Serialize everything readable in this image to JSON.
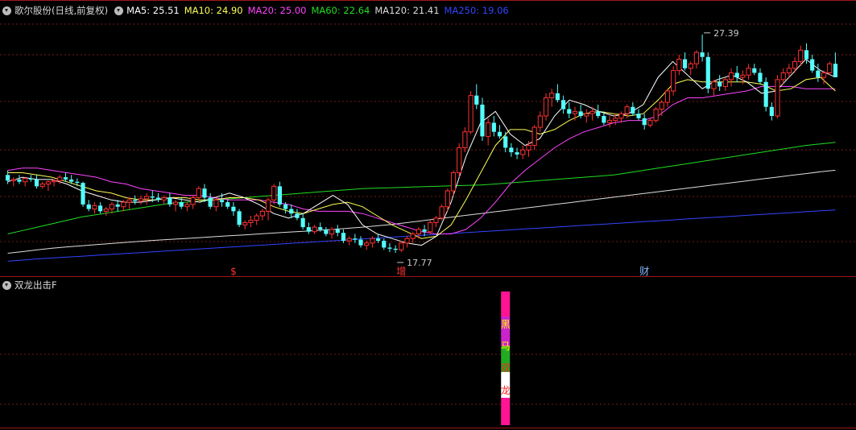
{
  "main_panel": {
    "title": "歌尔股份(日线,前复权)",
    "ma_legend": [
      {
        "label": "MA5: 25.51",
        "color": "#ffffff"
      },
      {
        "label": "MA10: 24.90",
        "color": "#ffff55"
      },
      {
        "label": "MA20: 25.00",
        "color": "#ff44ff"
      },
      {
        "label": "MA60: 22.64",
        "color": "#22dd22"
      },
      {
        "label": "MA120: 21.41",
        "color": "#dddddd"
      },
      {
        "label": "MA250: 19.06",
        "color": "#3344ff"
      }
    ],
    "high_label": "27.39",
    "low_label": "17.77",
    "markers": [
      {
        "text": "$",
        "color": "#ff3333",
        "day": 39
      },
      {
        "text": "增",
        "color": "#ff3333",
        "day": 68
      },
      {
        "text": "财",
        "color": "#88bbff",
        "day": 110
      },
      {
        "text": "$",
        "color": "#ff3333",
        "day": 160
      }
    ]
  },
  "sub_panel": {
    "title": "双龙出击F",
    "signals": [
      {
        "day": 86,
        "chars": [
          "黑",
          "马",
          "双",
          "龙"
        ],
        "char_colors": [
          "#ffff00",
          "#ffff00",
          "#ff2222",
          "#ff2222"
        ]
      },
      {
        "day": 157,
        "chars": [
          "黑",
          "马",
          "双",
          "龙"
        ],
        "char_colors": [
          "#ffff00",
          "#ffff00",
          "#ff2222",
          "#ff2222"
        ]
      }
    ]
  },
  "colors": {
    "up": "#ff3232",
    "down": "#54ffff",
    "grid": "#7a1a1a",
    "label": "#c8c8c8"
  },
  "chart_data": {
    "type": "candlestick",
    "price_range": [
      17.2,
      28.2
    ],
    "candles": [
      [
        21.2,
        21.4,
        20.8,
        20.95
      ],
      [
        20.95,
        21.1,
        20.7,
        21.0
      ],
      [
        21.0,
        21.2,
        20.8,
        20.9
      ],
      [
        20.9,
        21.1,
        20.7,
        21.05
      ],
      [
        21.05,
        21.2,
        20.9,
        21.0
      ],
      [
        21.0,
        21.2,
        20.6,
        20.7
      ],
      [
        20.7,
        20.9,
        20.6,
        20.8
      ],
      [
        20.8,
        20.95,
        20.5,
        20.9
      ],
      [
        20.9,
        21.0,
        20.7,
        20.95
      ],
      [
        20.95,
        21.2,
        20.8,
        21.1
      ],
      [
        21.1,
        21.3,
        20.9,
        21.0
      ],
      [
        21.0,
        21.2,
        20.8,
        20.9
      ],
      [
        20.9,
        21.05,
        20.7,
        20.85
      ],
      [
        20.85,
        20.9,
        19.8,
        19.9
      ],
      [
        19.9,
        20.1,
        19.6,
        19.7
      ],
      [
        19.7,
        20.0,
        19.5,
        19.85
      ],
      [
        19.85,
        20.0,
        19.5,
        19.6
      ],
      [
        19.6,
        19.8,
        19.4,
        19.7
      ],
      [
        19.7,
        20.0,
        19.5,
        19.9
      ],
      [
        19.9,
        20.1,
        19.6,
        19.8
      ],
      [
        19.8,
        20.1,
        19.6,
        20.0
      ],
      [
        20.0,
        20.2,
        19.7,
        20.1
      ],
      [
        20.1,
        20.3,
        19.9,
        20.05
      ],
      [
        20.05,
        20.3,
        19.9,
        20.15
      ],
      [
        20.15,
        20.4,
        19.9,
        20.25
      ],
      [
        20.25,
        20.5,
        20.0,
        20.2
      ],
      [
        20.2,
        20.4,
        20.0,
        20.1
      ],
      [
        20.1,
        20.3,
        19.9,
        20.2
      ],
      [
        20.2,
        20.4,
        19.8,
        19.9
      ],
      [
        19.9,
        20.1,
        19.6,
        20.0
      ],
      [
        20.0,
        20.2,
        19.7,
        19.8
      ],
      [
        19.8,
        20.0,
        19.6,
        19.9
      ],
      [
        19.9,
        20.3,
        19.7,
        20.2
      ],
      [
        20.2,
        20.7,
        20.0,
        20.6
      ],
      [
        20.6,
        20.8,
        20.0,
        20.2
      ],
      [
        20.2,
        20.4,
        19.7,
        19.8
      ],
      [
        19.8,
        20.2,
        19.6,
        20.1
      ],
      [
        20.1,
        20.4,
        19.8,
        20.0
      ],
      [
        20.0,
        20.1,
        19.7,
        19.8
      ],
      [
        19.8,
        20.0,
        19.4,
        19.6
      ],
      [
        19.6,
        19.7,
        18.9,
        19.0
      ],
      [
        19.0,
        19.2,
        18.8,
        19.1
      ],
      [
        19.1,
        19.4,
        18.9,
        19.2
      ],
      [
        19.2,
        19.5,
        19.0,
        19.4
      ],
      [
        19.4,
        19.7,
        19.2,
        19.6
      ],
      [
        19.6,
        20.2,
        19.2,
        20.1
      ],
      [
        20.1,
        20.8,
        19.9,
        20.7
      ],
      [
        20.7,
        20.9,
        19.8,
        19.9
      ],
      [
        19.9,
        20.0,
        19.5,
        19.7
      ],
      [
        19.7,
        19.9,
        19.3,
        19.5
      ],
      [
        19.5,
        19.7,
        19.2,
        19.3
      ],
      [
        19.3,
        19.5,
        18.8,
        18.9
      ],
      [
        18.9,
        19.1,
        18.6,
        18.7
      ],
      [
        18.7,
        19.0,
        18.6,
        18.9
      ],
      [
        18.9,
        19.1,
        18.7,
        18.8
      ],
      [
        18.8,
        18.9,
        18.5,
        18.6
      ],
      [
        18.6,
        18.9,
        18.4,
        18.8
      ],
      [
        18.8,
        19.0,
        18.5,
        18.65
      ],
      [
        18.65,
        18.8,
        18.2,
        18.3
      ],
      [
        18.3,
        18.5,
        18.1,
        18.4
      ],
      [
        18.4,
        18.6,
        18.2,
        18.35
      ],
      [
        18.35,
        18.5,
        18.0,
        18.1
      ],
      [
        18.1,
        18.3,
        17.9,
        18.2
      ],
      [
        18.2,
        18.5,
        18.0,
        18.4
      ],
      [
        18.4,
        18.6,
        18.2,
        18.3
      ],
      [
        18.3,
        18.4,
        17.9,
        18.0
      ],
      [
        18.0,
        18.2,
        17.8,
        17.95
      ],
      [
        17.95,
        18.1,
        17.77,
        17.9
      ],
      [
        17.9,
        18.3,
        17.8,
        18.2
      ],
      [
        18.2,
        18.5,
        18.0,
        18.4
      ],
      [
        18.4,
        18.7,
        18.2,
        18.6
      ],
      [
        18.6,
        18.9,
        18.4,
        18.8
      ],
      [
        18.8,
        19.0,
        18.5,
        18.7
      ],
      [
        18.7,
        19.2,
        18.6,
        19.1
      ],
      [
        19.1,
        19.4,
        18.9,
        19.3
      ],
      [
        19.3,
        19.9,
        19.2,
        19.8
      ],
      [
        19.8,
        20.6,
        19.6,
        20.5
      ],
      [
        20.5,
        21.4,
        20.3,
        21.3
      ],
      [
        21.3,
        22.6,
        21.1,
        22.4
      ],
      [
        22.4,
        23.3,
        22.2,
        23.1
      ],
      [
        23.1,
        24.9,
        23.0,
        24.7
      ],
      [
        24.7,
        25.2,
        24.1,
        24.3
      ],
      [
        24.3,
        24.6,
        22.7,
        22.9
      ],
      [
        22.9,
        23.7,
        22.5,
        23.5
      ],
      [
        23.5,
        23.8,
        22.9,
        23.1
      ],
      [
        23.1,
        23.4,
        22.8,
        22.9
      ],
      [
        22.9,
        23.1,
        22.2,
        22.4
      ],
      [
        22.4,
        22.6,
        22.0,
        22.2
      ],
      [
        22.2,
        22.4,
        21.9,
        22.1
      ],
      [
        22.1,
        22.5,
        21.9,
        22.3
      ],
      [
        22.3,
        22.7,
        22.0,
        22.5
      ],
      [
        22.5,
        23.4,
        22.3,
        23.3
      ],
      [
        23.3,
        24.0,
        23.1,
        23.8
      ],
      [
        23.8,
        24.8,
        23.6,
        24.6
      ],
      [
        24.6,
        25.0,
        24.2,
        24.8
      ],
      [
        24.8,
        25.2,
        24.4,
        24.5
      ],
      [
        24.5,
        24.7,
        23.9,
        24.1
      ],
      [
        24.1,
        24.4,
        23.7,
        23.9
      ],
      [
        23.9,
        24.2,
        23.6,
        24.0
      ],
      [
        24.0,
        24.3,
        23.7,
        23.8
      ],
      [
        23.8,
        24.1,
        23.5,
        23.9
      ],
      [
        23.9,
        24.2,
        23.6,
        24.0
      ],
      [
        24.0,
        24.3,
        23.7,
        23.8
      ],
      [
        23.8,
        24.0,
        23.4,
        23.5
      ],
      [
        23.5,
        23.8,
        23.3,
        23.6
      ],
      [
        23.6,
        23.9,
        23.4,
        23.7
      ],
      [
        23.7,
        24.0,
        23.5,
        23.9
      ],
      [
        23.9,
        24.3,
        23.7,
        24.2
      ],
      [
        24.2,
        24.4,
        23.8,
        23.9
      ],
      [
        23.9,
        24.1,
        23.6,
        23.7
      ],
      [
        23.7,
        23.9,
        23.2,
        23.4
      ],
      [
        23.4,
        23.7,
        23.3,
        23.6
      ],
      [
        23.6,
        24.2,
        23.5,
        24.1
      ],
      [
        24.1,
        24.5,
        23.8,
        24.4
      ],
      [
        24.4,
        25.0,
        24.2,
        24.9
      ],
      [
        24.9,
        26.0,
        24.7,
        25.8
      ],
      [
        25.8,
        26.5,
        25.6,
        26.3
      ],
      [
        26.3,
        26.6,
        25.8,
        25.9
      ],
      [
        25.9,
        26.2,
        25.6,
        26.1
      ],
      [
        26.1,
        26.7,
        25.9,
        26.6
      ],
      [
        26.6,
        27.39,
        26.2,
        26.4
      ],
      [
        26.4,
        26.6,
        24.8,
        25.0
      ],
      [
        25.0,
        25.4,
        24.7,
        25.3
      ],
      [
        25.3,
        25.6,
        24.9,
        25.1
      ],
      [
        25.1,
        25.5,
        24.9,
        25.4
      ],
      [
        25.4,
        25.9,
        25.1,
        25.7
      ],
      [
        25.7,
        26.0,
        25.3,
        25.5
      ],
      [
        25.5,
        25.8,
        25.2,
        25.6
      ],
      [
        25.6,
        26.1,
        25.4,
        25.9
      ],
      [
        25.9,
        26.1,
        25.6,
        25.7
      ],
      [
        25.7,
        25.9,
        25.2,
        25.3
      ],
      [
        25.3,
        25.5,
        24.0,
        24.2
      ],
      [
        24.2,
        24.4,
        23.6,
        23.8
      ],
      [
        23.8,
        25.6,
        23.7,
        25.4
      ],
      [
        25.4,
        25.9,
        25.2,
        25.7
      ],
      [
        25.7,
        26.1,
        25.5,
        25.9
      ],
      [
        25.9,
        26.4,
        25.7,
        26.2
      ],
      [
        26.2,
        26.9,
        26.0,
        26.7
      ],
      [
        26.7,
        27.0,
        26.1,
        26.3
      ],
      [
        26.3,
        26.5,
        25.7,
        25.8
      ],
      [
        25.8,
        26.1,
        25.3,
        25.5
      ],
      [
        25.5,
        25.8,
        25.2,
        25.7
      ],
      [
        25.7,
        26.2,
        25.6,
        26.1
      ],
      [
        26.1,
        26.6,
        25.9,
        25.51
      ]
    ],
    "moving_averages": [
      {
        "name": "MA5",
        "color": "#ffffff",
        "values": [
          20.9,
          21.1,
          21.0,
          21.0,
          20.8,
          20.5,
          20.3,
          20.1,
          20.0,
          20.0,
          20.1,
          20.2,
          20.1,
          20.0,
          20.2,
          20.4,
          20.2,
          19.9,
          19.5,
          19.3,
          19.5,
          19.9,
          20.3,
          19.9,
          19.0,
          18.6,
          18.4,
          18.2,
          18.1,
          18.5,
          20.0,
          22.0,
          23.5,
          24.0,
          23.0,
          22.5,
          22.8,
          23.8,
          24.5,
          24.3,
          24.0,
          23.8,
          23.9,
          24.3,
          25.5,
          26.2,
          25.6,
          25.0,
          25.4,
          25.6,
          25.3,
          24.8,
          24.9,
          25.6,
          26.3,
          25.8,
          25.51
        ]
      },
      {
        "name": "MA10",
        "color": "#ffff55",
        "values": [
          21.3,
          21.3,
          21.2,
          21.1,
          20.9,
          20.7,
          20.5,
          20.4,
          20.2,
          20.1,
          20.1,
          20.2,
          20.2,
          20.1,
          20.1,
          20.2,
          20.2,
          20.1,
          19.8,
          19.6,
          19.5,
          19.7,
          19.9,
          20.0,
          19.8,
          19.4,
          19.0,
          18.7,
          18.4,
          18.5,
          19.0,
          20.1,
          21.3,
          22.5,
          23.2,
          23.2,
          23.0,
          23.2,
          23.6,
          23.9,
          24.0,
          23.9,
          23.8,
          23.9,
          24.5,
          25.2,
          25.4,
          25.3,
          25.3,
          25.3,
          25.3,
          25.2,
          24.9,
          25.0,
          25.4,
          25.5,
          24.9
        ]
      },
      {
        "name": "MA20",
        "color": "#ff44ff",
        "values": [
          21.4,
          21.5,
          21.5,
          21.4,
          21.3,
          21.2,
          21.1,
          20.9,
          20.8,
          20.6,
          20.5,
          20.4,
          20.3,
          20.3,
          20.2,
          20.1,
          20.1,
          20.1,
          20.0,
          19.9,
          19.7,
          19.6,
          19.6,
          19.6,
          19.5,
          19.3,
          19.1,
          18.9,
          18.7,
          18.6,
          18.6,
          18.8,
          19.3,
          20.0,
          20.8,
          21.4,
          21.9,
          22.4,
          22.8,
          23.1,
          23.3,
          23.5,
          23.6,
          23.6,
          23.8,
          24.3,
          24.6,
          24.6,
          24.7,
          24.8,
          24.9,
          25.1,
          25.1,
          25.1,
          25.0,
          25.0,
          25.0
        ]
      },
      {
        "name": "MA60",
        "color": "#22dd22",
        "values": [
          18.6,
          18.75,
          18.9,
          19.05,
          19.2,
          19.35,
          19.45,
          19.55,
          19.65,
          19.75,
          19.85,
          19.95,
          20.0,
          20.05,
          20.1,
          20.15,
          20.2,
          20.25,
          20.3,
          20.35,
          20.4,
          20.45,
          20.5,
          20.55,
          20.6,
          20.62,
          20.64,
          20.66,
          20.68,
          20.7,
          20.72,
          20.74,
          20.76,
          20.8,
          20.85,
          20.9,
          20.95,
          21.0,
          21.05,
          21.1,
          21.15,
          21.2,
          21.3,
          21.4,
          21.5,
          21.6,
          21.7,
          21.8,
          21.9,
          22.0,
          22.1,
          22.2,
          22.3,
          22.4,
          22.5,
          22.57,
          22.64
        ]
      },
      {
        "name": "MA120",
        "color": "#dddddd",
        "values": [
          17.75,
          17.82,
          17.9,
          17.97,
          18.03,
          18.08,
          18.13,
          18.18,
          18.23,
          18.28,
          18.32,
          18.36,
          18.4,
          18.44,
          18.48,
          18.52,
          18.56,
          18.6,
          18.64,
          18.68,
          18.72,
          18.76,
          18.8,
          18.85,
          18.9,
          18.96,
          19.02,
          19.1,
          19.18,
          19.26,
          19.34,
          19.42,
          19.5,
          19.58,
          19.66,
          19.74,
          19.82,
          19.9,
          19.98,
          20.06,
          20.14,
          20.22,
          20.3,
          20.38,
          20.46,
          20.54,
          20.62,
          20.7,
          20.78,
          20.86,
          20.94,
          21.02,
          21.1,
          21.18,
          21.26,
          21.34,
          21.41
        ]
      },
      {
        "name": "MA250",
        "color": "#3344ff",
        "values": [
          17.4,
          17.45,
          17.5,
          17.54,
          17.58,
          17.62,
          17.66,
          17.7,
          17.74,
          17.78,
          17.82,
          17.86,
          17.9,
          17.94,
          17.98,
          18.02,
          18.06,
          18.1,
          18.14,
          18.18,
          18.22,
          18.26,
          18.3,
          18.34,
          18.38,
          18.42,
          18.46,
          18.5,
          18.54,
          18.58,
          18.62,
          18.66,
          18.7,
          18.74,
          18.78,
          18.82,
          18.86,
          18.9,
          18.94,
          18.98,
          19.02,
          19.06,
          19.1,
          19.14,
          19.18,
          19.22,
          19.26,
          19.3,
          19.34,
          19.38,
          19.42,
          19.46,
          19.5,
          19.54,
          19.58,
          19.62,
          19.66
        ]
      }
    ]
  }
}
